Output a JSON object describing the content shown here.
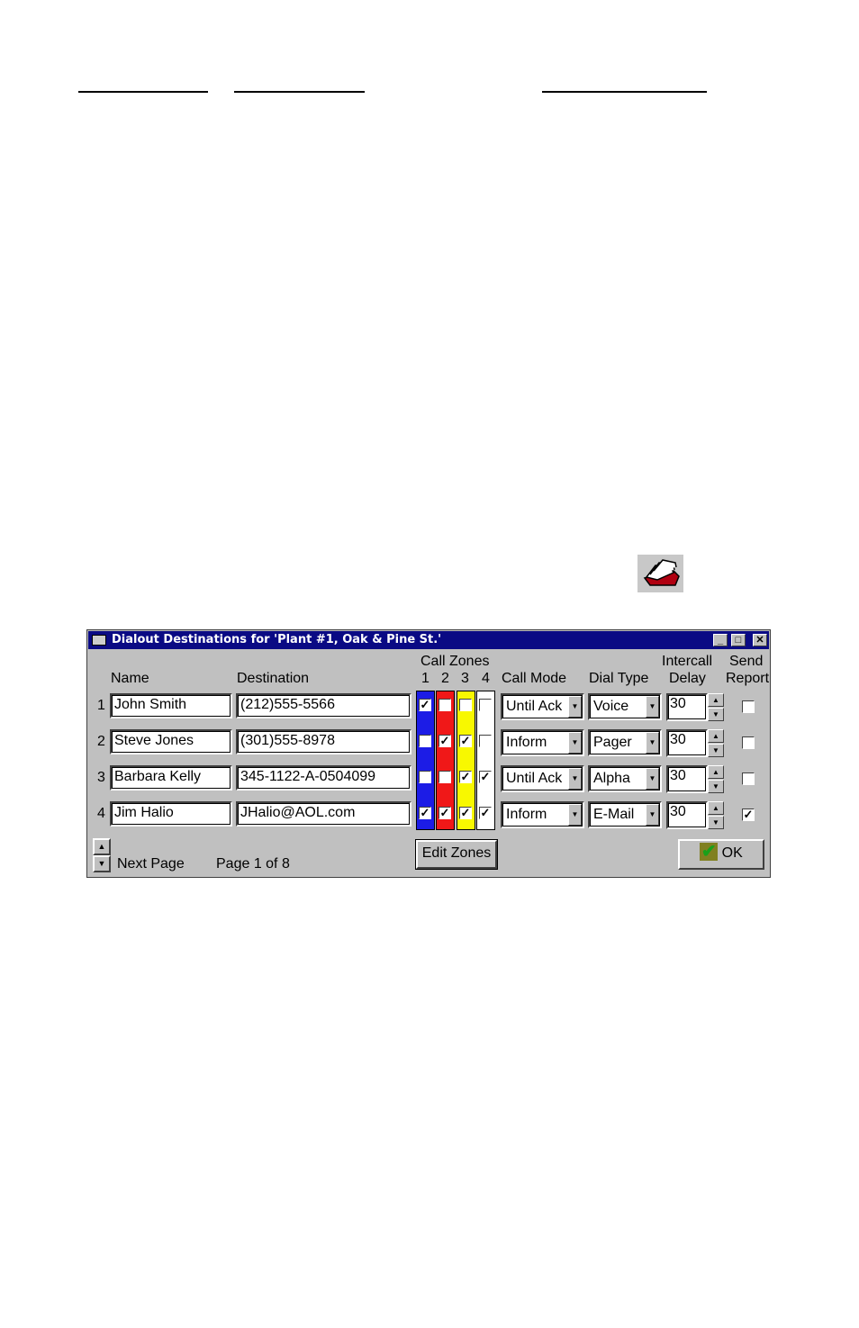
{
  "window": {
    "title": "Dialout Destinations for 'Plant #1, Oak & Pine St.'",
    "controls": {
      "minimize": "_",
      "maximize": "□",
      "close": "✕"
    }
  },
  "headers": {
    "name": "Name",
    "destination": "Destination",
    "call_zones": "Call Zones",
    "zone_numbers": [
      "1",
      "2",
      "3",
      "4"
    ],
    "call_mode": "Call Mode",
    "dial_type": "Dial Type",
    "intercall_line1": "Intercall",
    "intercall_line2": "Delay",
    "send_line1": "Send",
    "send_line2": "Report"
  },
  "zone_colors": [
    "#1c1ce6",
    "#f01818",
    "#f8f800",
    "#ffffff"
  ],
  "rows": [
    {
      "num": "1",
      "name": "John Smith",
      "destination": "(212)555-5566",
      "zones": [
        true,
        false,
        false,
        false
      ],
      "call_mode": "Until Ack",
      "dial_type": "Voice",
      "delay": "30",
      "send_report": false
    },
    {
      "num": "2",
      "name": "Steve Jones",
      "destination": "(301)555-8978",
      "zones": [
        false,
        true,
        true,
        false
      ],
      "call_mode": "Inform",
      "dial_type": "Pager",
      "delay": "30",
      "send_report": false
    },
    {
      "num": "3",
      "name": "Barbara Kelly",
      "destination": "345-1122-A-0504099",
      "zones": [
        false,
        false,
        true,
        true
      ],
      "call_mode": "Until Ack",
      "dial_type": "Alpha",
      "delay": "30",
      "send_report": false
    },
    {
      "num": "4",
      "name": "Jim Halio",
      "destination": "JHalio@AOL.com",
      "zones": [
        true,
        true,
        true,
        true
      ],
      "call_mode": "Inform",
      "dial_type": "E-Mail",
      "delay": "30",
      "send_report": true
    }
  ],
  "footer": {
    "next_page": "Next Page",
    "page_info": "Page 1 of 8",
    "edit_zones": "Edit Zones",
    "ok": "OK"
  },
  "icons": {
    "card_file": "card-file-icon"
  }
}
